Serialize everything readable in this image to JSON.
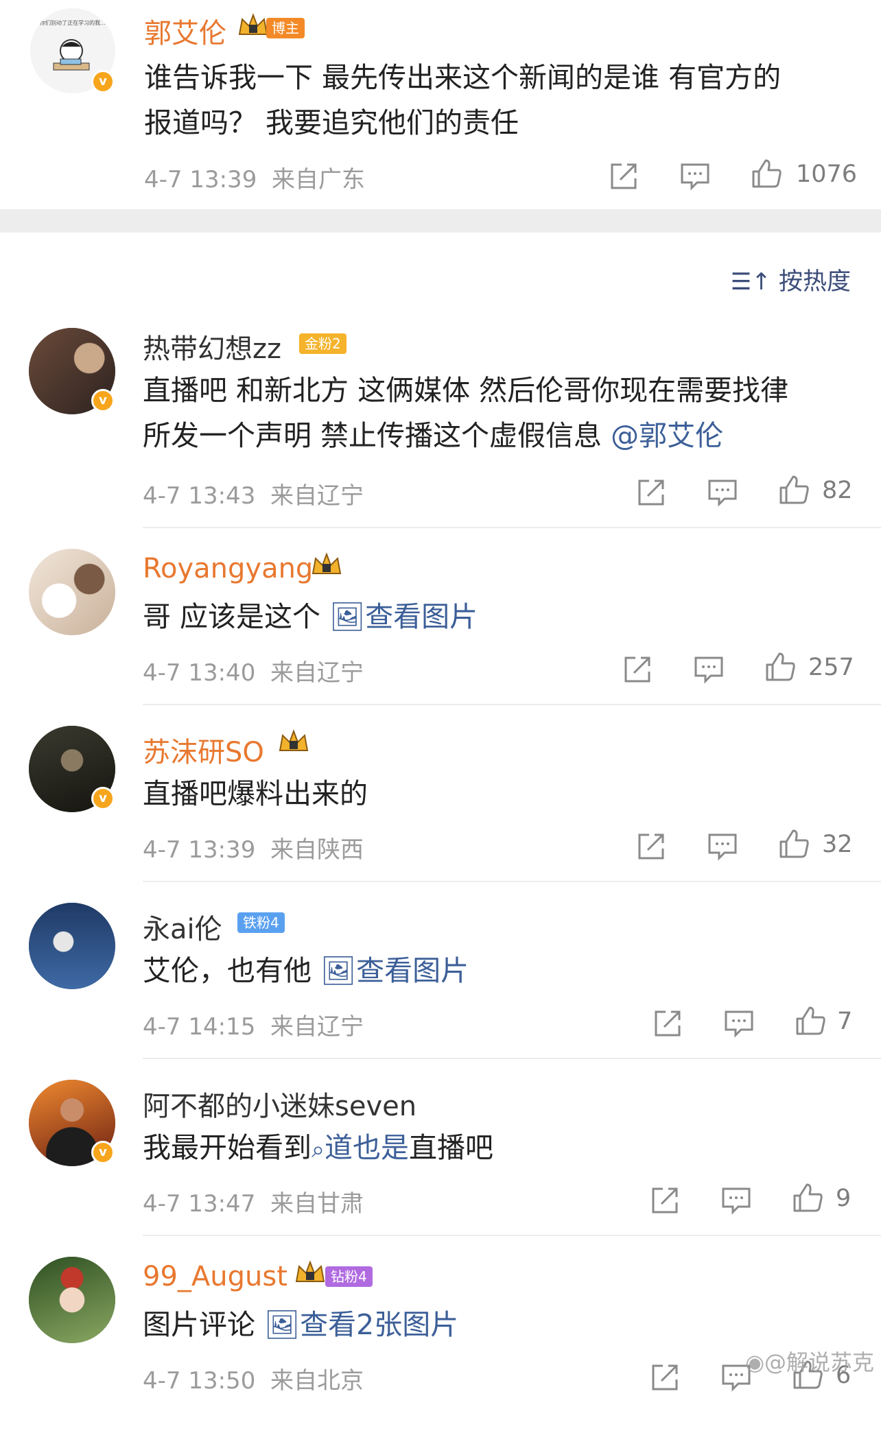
{
  "top_post": {
    "author": "郭艾伦",
    "badge": "博主",
    "avatar_caption": "你们别动了正在学习的我...",
    "text_line1": "谁告诉我一下 最先传出来这个新闻的是谁 有官方的",
    "text_line2": "报道吗？ 我要追究他们的责任",
    "time": "4-7 13:39",
    "location": "来自广东",
    "likes": "1076"
  },
  "sort_label": "按热度",
  "comments": [
    {
      "author": "热带幻想zz",
      "badge": "金粉2",
      "line1": "直播吧 和新北方 这俩媒体 然后伦哥你现在需要找律",
      "line2_text": "所发一个声明 禁止传播这个虚假信息 ",
      "line2_link": "@郭艾伦",
      "time": "4-7 13:43",
      "location": "来自辽宁",
      "likes": "82"
    },
    {
      "author": "Royangyang",
      "text": "哥 应该是这个 ",
      "link": "查看图片",
      "time": "4-7 13:40",
      "location": "来自辽宁",
      "likes": "257"
    },
    {
      "author": "苏沫研SO",
      "text": "直播吧爆料出来的",
      "time": "4-7 13:39",
      "location": "来自陕西",
      "likes": "32"
    },
    {
      "author": "永ai伦",
      "badge": "铁粉4",
      "text": "艾伦，也有他 ",
      "link": "查看图片",
      "time": "4-7 14:15",
      "location": "来自辽宁",
      "likes": "7"
    },
    {
      "author": "阿不都的小迷妹seven",
      "text": "我最开始看到",
      "link": "道也是",
      "text_after": "直播吧",
      "time": "4-7 13:47",
      "location": "来自甘肃",
      "likes": "9"
    },
    {
      "author": "99_August",
      "badge": "钻粉4",
      "text": "图片评论 ",
      "link": "查看2张图片",
      "time": "4-7 13:50",
      "location": "来自北京",
      "likes": "6"
    }
  ],
  "watermark": "@解说苏克",
  "colors": {
    "orange_name": "#e8782f",
    "link": "#3c5f98",
    "gold_badge": "#f5b32b",
    "iron_badge": "#5aa0f0",
    "diamond_badge": "#b06be0"
  }
}
